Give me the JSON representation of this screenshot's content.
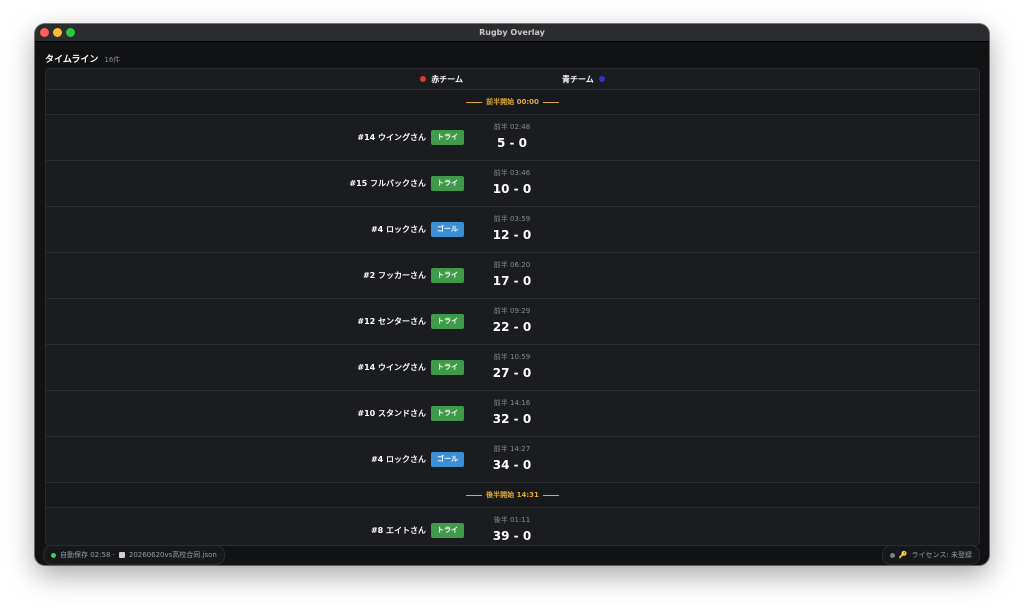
{
  "window": {
    "title": "Rugby Overlay"
  },
  "header": {
    "title": "タイムライン",
    "count": "16件"
  },
  "teams": {
    "red": {
      "name": "赤チーム",
      "color": "#e03a2f"
    },
    "blue": {
      "name": "青チーム",
      "color": "#2a36c9"
    }
  },
  "colors": {
    "try_badge": "#3f9b4a",
    "goal_badge": "#3b8fd6",
    "half_label": "#e0a93a",
    "autosave_dot": "#3fd15b",
    "license_dot": "#7d7e83"
  },
  "halves": {
    "first": {
      "label": "前半開始 00:00"
    },
    "second": {
      "label": "後半開始 14:31"
    }
  },
  "events": [
    {
      "player": "#14 ウイングさん",
      "type": "トライ",
      "kind": "try",
      "time": "前半 02:48",
      "score": "5 - 0"
    },
    {
      "player": "#15 フルバックさん",
      "type": "トライ",
      "kind": "try",
      "time": "前半 03:46",
      "score": "10 - 0"
    },
    {
      "player": "#4 ロックさん",
      "type": "ゴール",
      "kind": "goal",
      "time": "前半 03:59",
      "score": "12 - 0"
    },
    {
      "player": "#2 フッカーさん",
      "type": "トライ",
      "kind": "try",
      "time": "前半 06:20",
      "score": "17 - 0"
    },
    {
      "player": "#12 センターさん",
      "type": "トライ",
      "kind": "try",
      "time": "前半 09:29",
      "score": "22 - 0"
    },
    {
      "player": "#14 ウイングさん",
      "type": "トライ",
      "kind": "try",
      "time": "前半 10:59",
      "score": "27 - 0"
    },
    {
      "player": "#10 スタンドさん",
      "type": "トライ",
      "kind": "try",
      "time": "前半 14:16",
      "score": "32 - 0"
    },
    {
      "player": "#4 ロックさん",
      "type": "ゴール",
      "kind": "goal",
      "time": "前半 14:27",
      "score": "34 - 0"
    },
    {
      "player": "#8 エイトさん",
      "type": "トライ",
      "kind": "try",
      "time": "後半 01:11",
      "score": "39 - 0"
    }
  ],
  "footer": {
    "autosave": "自動保存 02:58 ·",
    "filename": "20260620vs高校合同.json",
    "license": "ライセンス: 未登録"
  }
}
